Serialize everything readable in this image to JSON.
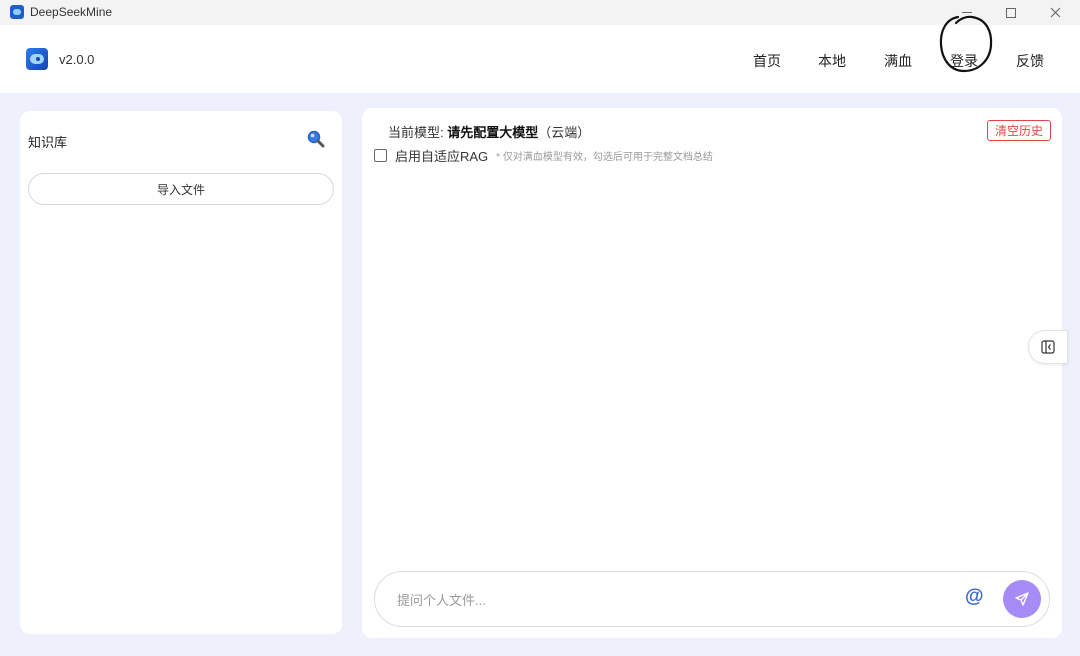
{
  "window": {
    "title": "DeepSeekMine"
  },
  "header": {
    "version": "v2.0.0",
    "nav": {
      "home": "首页",
      "local": "本地",
      "full": "满血",
      "login": "登录",
      "feedback": "反馈"
    }
  },
  "sidebar": {
    "title": "知识库",
    "import_button": "导入文件"
  },
  "main": {
    "model_prefix": "当前模型: ",
    "model_name": "请先配置大模型",
    "model_suffix": "（云端）",
    "clear_history": "清空历史",
    "rag_label": "启用自适应RAG",
    "rag_hint": "* 仅对满血模型有效，勾选后可用于完整文档总结",
    "rag_checked": false,
    "input_placeholder": "提问个人文件...",
    "at_symbol": "@"
  },
  "colors": {
    "accent": "#a58bf5",
    "danger": "#e04848",
    "background": "#eef0fb"
  }
}
